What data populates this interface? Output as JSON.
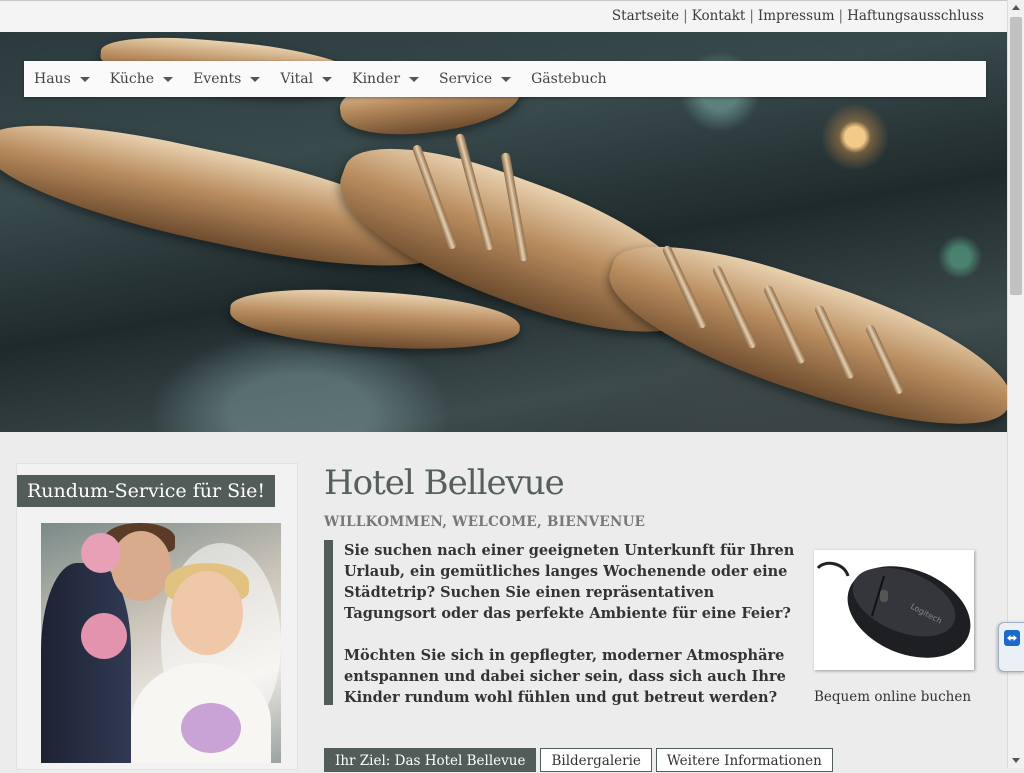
{
  "top_links": {
    "startseite": "Startseite",
    "kontakt": "Kontakt",
    "impressum": "Impressum",
    "haftung": "Haftungsausschluss",
    "separator": "|"
  },
  "nav": {
    "items": [
      {
        "label": "Haus",
        "has_dropdown": true
      },
      {
        "label": "Küche",
        "has_dropdown": true
      },
      {
        "label": "Events",
        "has_dropdown": true
      },
      {
        "label": "Vital",
        "has_dropdown": true
      },
      {
        "label": "Kinder",
        "has_dropdown": true
      },
      {
        "label": "Service",
        "has_dropdown": true
      },
      {
        "label": "Gästebuch",
        "has_dropdown": false
      }
    ]
  },
  "sidebar": {
    "title": "Rundum-Service für Sie!"
  },
  "main": {
    "title": "Hotel Bellevue",
    "subtitle": "WILLKOMMEN, WELCOME, BIENVENUE",
    "paragraph1": "Sie suchen nach einer geeigneten Unterkunft für Ihren Urlaub, ein gemütliches langes Wochenende oder eine Städtetrip? Suchen Sie einen repräsentativen Tagungsort oder das perfekte Ambiente für eine Feier?",
    "paragraph2": "Möchten Sie sich in gepflegter, moderner Atmosphäre entspannen und dabei sicher sein, dass sich auch Ihre Kinder rundum wohl fühlen und gut betreut werden?",
    "booking_caption": "Bequem online buchen",
    "tabs": [
      {
        "label": "Ihr Ziel: Das Hotel Bellevue",
        "active": true
      },
      {
        "label": "Bildergalerie",
        "active": false
      },
      {
        "label": "Weitere Informationen",
        "active": false
      }
    ]
  },
  "colors": {
    "accent": "#525d5a",
    "page_background": "#ececec"
  }
}
